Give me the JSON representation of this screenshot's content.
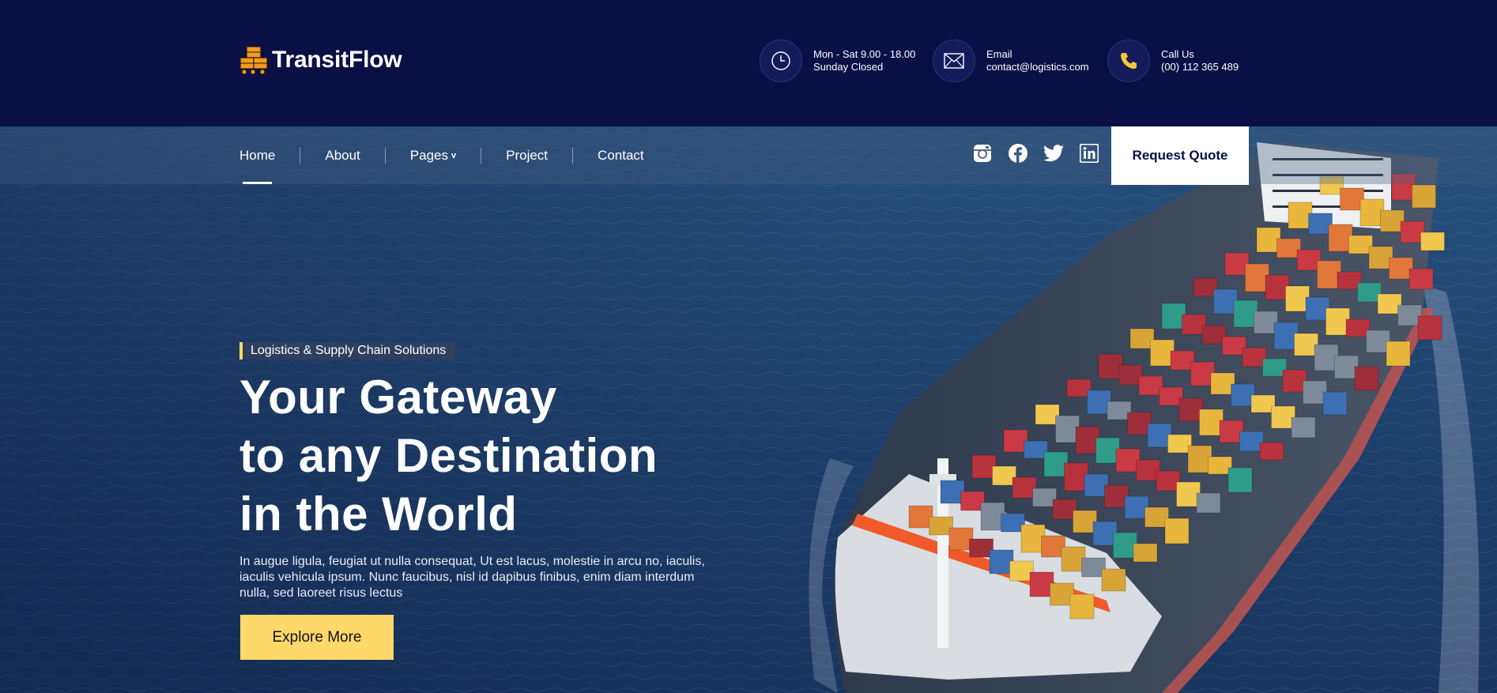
{
  "brand": {
    "name": "TransitFlow"
  },
  "header": {
    "hours": {
      "line1": "Mon - Sat 9.00 - 18.00",
      "line2": "Sunday Closed",
      "icon": "clock-icon"
    },
    "email": {
      "line1": "Email",
      "line2": "contact@logistics.com",
      "icon": "envelope-icon"
    },
    "phone": {
      "line1": "Call Us",
      "line2": "(00) 112 365 489",
      "icon": "phone-icon"
    }
  },
  "nav": {
    "items": [
      {
        "label": "Home",
        "active": true
      },
      {
        "label": "About"
      },
      {
        "label": "Pages",
        "dropdown": true
      },
      {
        "label": "Project"
      },
      {
        "label": "Contact"
      }
    ],
    "dropdown_indicator": "v"
  },
  "socials": [
    "instagram-icon",
    "facebook-icon",
    "twitter-icon",
    "linkedin-icon"
  ],
  "cta": {
    "quote_label": "Request Quote"
  },
  "hero": {
    "tagline": "Logistics & Supply Chain Solutions",
    "headline": [
      "Your Gateway",
      "to any Destination",
      "in the World"
    ],
    "description": "In augue ligula, feugiat ut nulla consequat, Ut est lacus, molestie in arcu no, iaculis, iaculis vehicula ipsum. Nunc faucibus, nisl id dapibus finibus, enim diam interdum nulla, sed laoreet risus lectus",
    "button_label": "Explore More"
  },
  "colors": {
    "header_bg": "#0a0f45",
    "accent_yellow": "#ffd86b",
    "white": "#ffffff",
    "icon_gold": "#f5c542",
    "logo_orange": "#f59a1c"
  }
}
